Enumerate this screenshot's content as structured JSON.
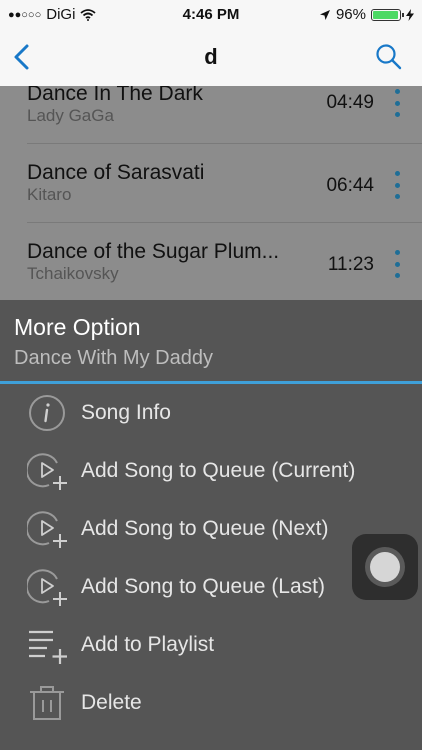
{
  "status": {
    "carrier": "DiGi",
    "signal_dots": "●●○○○",
    "time": "4:46 PM",
    "battery": "96%",
    "battery_level": 0.96
  },
  "nav": {
    "title": "d",
    "back_icon": "chevron-left-icon",
    "search_icon": "search-icon"
  },
  "songs": [
    {
      "title": "Dance In The Dark",
      "artist": "Lady GaGa",
      "duration": "04:49"
    },
    {
      "title": "Dance of Sarasvati",
      "artist": "Kitaro",
      "duration": "06:44"
    },
    {
      "title": "Dance of the Sugar Plum...",
      "artist": "Tchaikovsky",
      "duration": "11:23"
    }
  ],
  "sheet": {
    "title": "More Option",
    "subtitle": "Dance With My Daddy",
    "accent_color": "#3fa0d9",
    "options": [
      {
        "label": "Song Info",
        "icon": "info-icon"
      },
      {
        "label": "Add Song to Queue (Current)",
        "icon": "play-add-icon"
      },
      {
        "label": "Add Song to Queue (Next)",
        "icon": "play-add-icon"
      },
      {
        "label": "Add Song to Queue (Last)",
        "icon": "play-add-icon"
      },
      {
        "label": "Add to Playlist",
        "icon": "playlist-add-icon"
      },
      {
        "label": "Delete",
        "icon": "trash-icon"
      }
    ]
  }
}
